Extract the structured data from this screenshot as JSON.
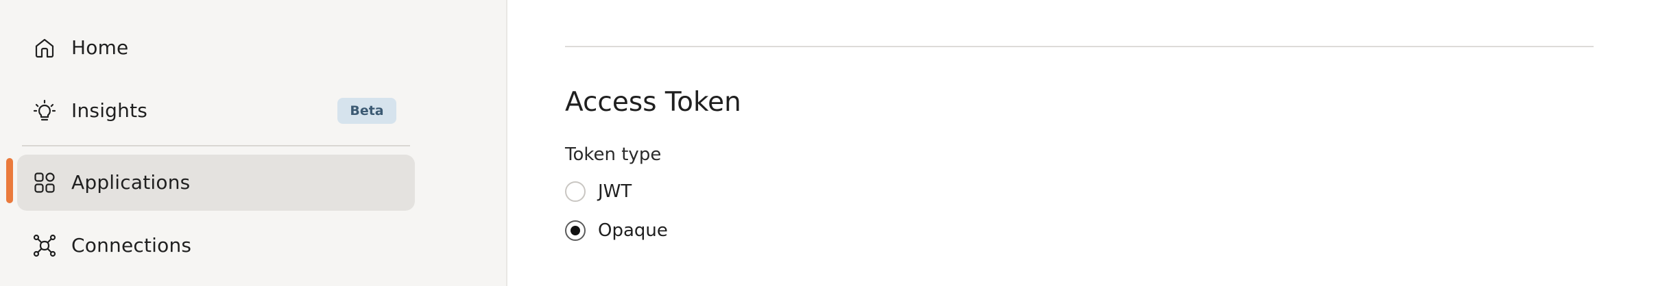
{
  "sidebar": {
    "items": [
      {
        "label": "Home",
        "icon": "home-icon",
        "active": false
      },
      {
        "label": "Insights",
        "icon": "lightbulb-icon",
        "badge": "Beta",
        "active": false
      },
      {
        "label": "Applications",
        "icon": "grid-icon",
        "active": true
      },
      {
        "label": "Connections",
        "icon": "network-icon",
        "active": false
      }
    ]
  },
  "main": {
    "section_title": "Access Token",
    "token_type": {
      "label": "Token type",
      "options": [
        {
          "label": "JWT",
          "selected": false
        },
        {
          "label": "Opaque",
          "selected": true
        }
      ]
    }
  },
  "colors": {
    "accent": "#ea7a3c",
    "badge_bg": "#d6e3ed",
    "badge_text": "#3c5a73",
    "sidebar_bg": "#f6f5f3",
    "active_bg": "#e4e2df"
  }
}
